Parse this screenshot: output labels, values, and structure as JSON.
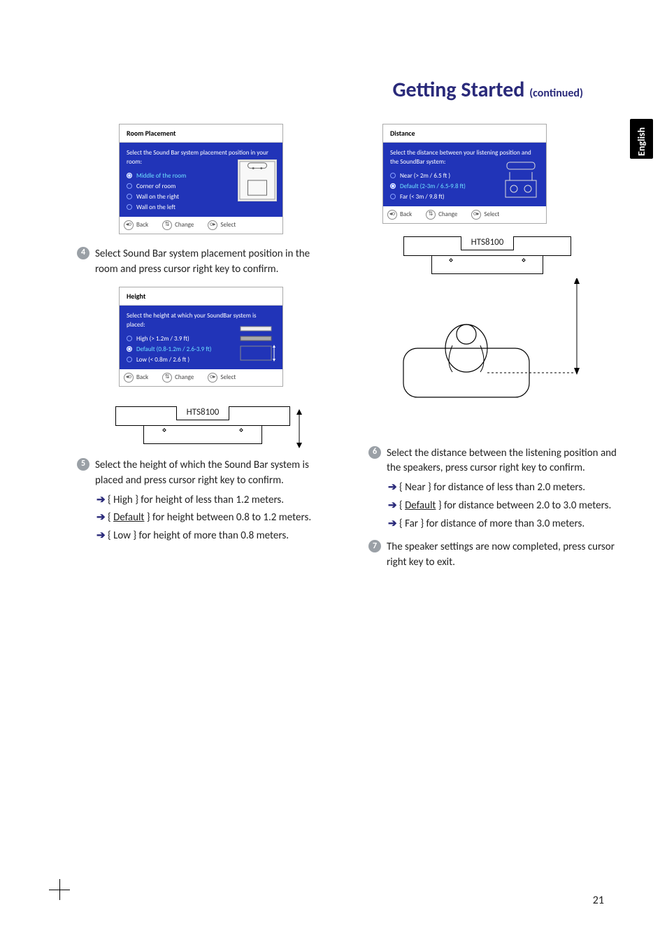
{
  "heading": {
    "main": "Getting Started",
    "cont": "(continued)"
  },
  "langTab": "English",
  "dialogRoom": {
    "title": "Room Placement",
    "prompt": "Select the Sound Bar system placement position in your room:",
    "options": [
      {
        "label": "Middle of the room",
        "selected": true
      },
      {
        "label": "Corner of room",
        "selected": false
      },
      {
        "label": "Wall on the right",
        "selected": false
      },
      {
        "label": "Wall on the left",
        "selected": false
      }
    ]
  },
  "dialogHeight": {
    "title": "Height",
    "prompt": "Select the height at which your SoundBar system is placed:",
    "options": [
      {
        "label": "High (> 1.2m / 3.9 ft)",
        "selected": false
      },
      {
        "label": "Default (0.8-1.2m / 2.6-3.9 ft)",
        "selected": true
      },
      {
        "label": "Low (< 0.8m / 2.6 ft )",
        "selected": false
      }
    ]
  },
  "dialogDistance": {
    "title": "Distance",
    "prompt": "Select the distance between your listening position and the SoundBar system:",
    "options": [
      {
        "label": "Near (> 2m / 6.5 ft )",
        "selected": false
      },
      {
        "label": "Default (2-3m / 6.5-9.8 ft)",
        "selected": true
      },
      {
        "label": "Far (< 3m / 9.8 ft)",
        "selected": false
      }
    ]
  },
  "footerBtns": {
    "back": "Back",
    "change": "Change",
    "select": "Select"
  },
  "device": {
    "model": "HTS8100"
  },
  "steps": {
    "s4": {
      "num": "4",
      "text": "Select Sound Bar system placement position in the room and press cursor right key to confirm."
    },
    "s5": {
      "num": "5",
      "text": "Select the height of which the Sound Bar system is placed and press cursor right key to confirm.",
      "sub": [
        {
          "opt": "High",
          "rest": " } for height of less than 1.2 meters."
        },
        {
          "opt": "Default",
          "rest": " } for height between 0.8 to 1.2 meters.",
          "underline": true
        },
        {
          "opt": "Low",
          "rest": " } for height of more than 0.8 meters."
        }
      ]
    },
    "s6": {
      "num": "6",
      "text": "Select the distance between the listening position and the speakers, press cursor right key to confirm.",
      "sub": [
        {
          "opt": "Near",
          "rest": " } for distance of less than 2.0 meters."
        },
        {
          "opt": "Default",
          "rest": " } for distance between 2.0 to 3.0 meters.",
          "underline": true
        },
        {
          "opt": "Far",
          "rest": " } for distance of more than 3.0 meters."
        }
      ]
    },
    "s7": {
      "num": "7",
      "text": "The speaker settings are now completed, press cursor right key to exit."
    }
  },
  "pageNum": "21"
}
